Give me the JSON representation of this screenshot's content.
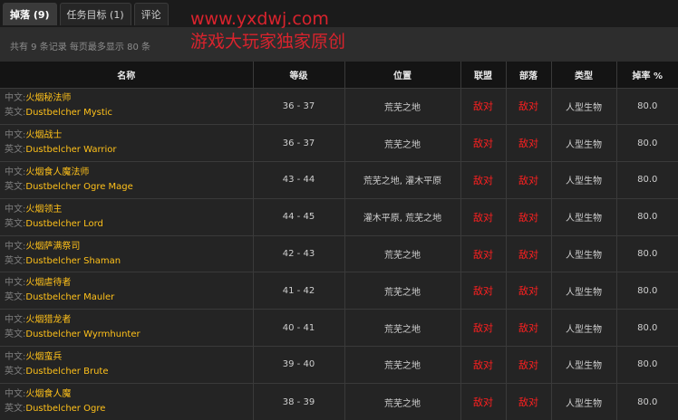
{
  "tabs": [
    {
      "label": "掉落 (9)",
      "active": true
    },
    {
      "label": "任务目标 (1)",
      "active": false
    },
    {
      "label": "评论",
      "active": false
    }
  ],
  "info": "共有 9 条记录 每页最多显示 80 条",
  "watermark": {
    "url": "www.yxdwj.com",
    "subtitle": "游戏大玩家独家原创"
  },
  "table": {
    "headers": [
      "名称",
      "等级",
      "位置",
      "联盟",
      "部落",
      "类型",
      "掉率 %"
    ],
    "cn_prefix": "中文:",
    "en_prefix": "英文:",
    "rows": [
      {
        "cn": "火烟秘法师",
        "en": "Dustbelcher Mystic",
        "level": "36 - 37",
        "location": "荒芜之地",
        "alliance": "敌对",
        "horde": "敌对",
        "type": "人型生物",
        "rate": "80.0"
      },
      {
        "cn": "火烟战士",
        "en": "Dustbelcher Warrior",
        "level": "36 - 37",
        "location": "荒芜之地",
        "alliance": "敌对",
        "horde": "敌对",
        "type": "人型生物",
        "rate": "80.0"
      },
      {
        "cn": "火烟食人魔法师",
        "en": "Dustbelcher Ogre Mage",
        "level": "43 - 44",
        "location": "荒芜之地, 灌木平原",
        "alliance": "敌对",
        "horde": "敌对",
        "type": "人型生物",
        "rate": "80.0"
      },
      {
        "cn": "火烟领主",
        "en": "Dustbelcher Lord",
        "level": "44 - 45",
        "location": "灌木平原, 荒芜之地",
        "alliance": "敌对",
        "horde": "敌对",
        "type": "人型生物",
        "rate": "80.0"
      },
      {
        "cn": "火烟萨满祭司",
        "en": "Dustbelcher Shaman",
        "level": "42 - 43",
        "location": "荒芜之地",
        "alliance": "敌对",
        "horde": "敌对",
        "type": "人型生物",
        "rate": "80.0"
      },
      {
        "cn": "火烟虐待者",
        "en": "Dustbelcher Mauler",
        "level": "41 - 42",
        "location": "荒芜之地",
        "alliance": "敌对",
        "horde": "敌对",
        "type": "人型生物",
        "rate": "80.0"
      },
      {
        "cn": "火烟猎龙者",
        "en": "Dustbelcher Wyrmhunter",
        "level": "40 - 41",
        "location": "荒芜之地",
        "alliance": "敌对",
        "horde": "敌对",
        "type": "人型生物",
        "rate": "80.0"
      },
      {
        "cn": "火烟蛮兵",
        "en": "Dustbelcher Brute",
        "level": "39 - 40",
        "location": "荒芜之地",
        "alliance": "敌对",
        "horde": "敌对",
        "type": "人型生物",
        "rate": "80.0"
      },
      {
        "cn": "火烟食人魔",
        "en": "Dustbelcher Ogre",
        "level": "38 - 39",
        "location": "荒芜之地",
        "alliance": "敌对",
        "horde": "敌对",
        "type": "人型生物",
        "rate": "80.0"
      }
    ]
  }
}
